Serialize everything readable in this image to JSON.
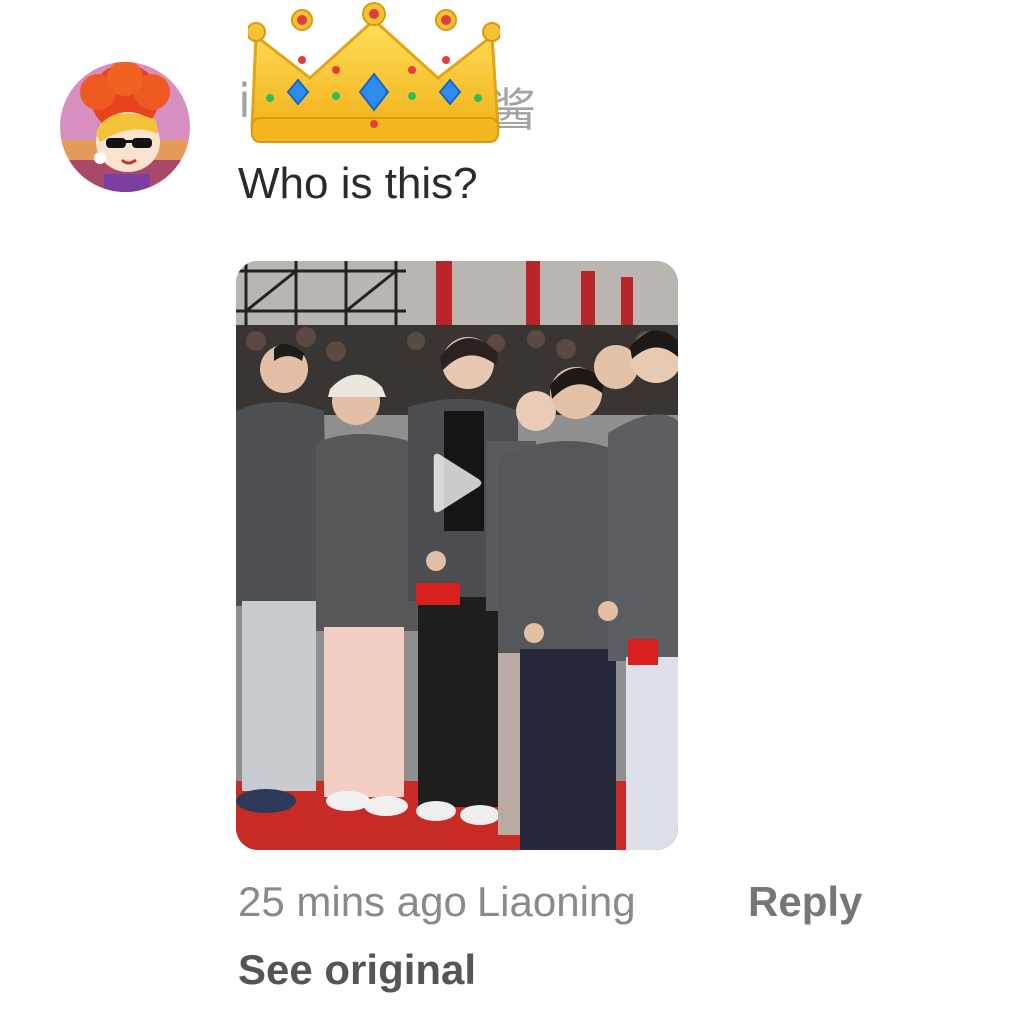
{
  "comment": {
    "username_visible_start": "i",
    "username_visible_end": "酱",
    "badge_icon": "crown-emoji",
    "text": "Who is this?",
    "timestamp": "25 mins ago",
    "location": "Liaoning",
    "reply_label": "Reply",
    "see_original_label": "See original"
  },
  "avatar": {
    "icon": "cartoon-avatar",
    "hair_color": "#e8431f"
  },
  "attachment": {
    "type": "video",
    "icon": "play-icon",
    "carpet_color": "#c82a25"
  }
}
